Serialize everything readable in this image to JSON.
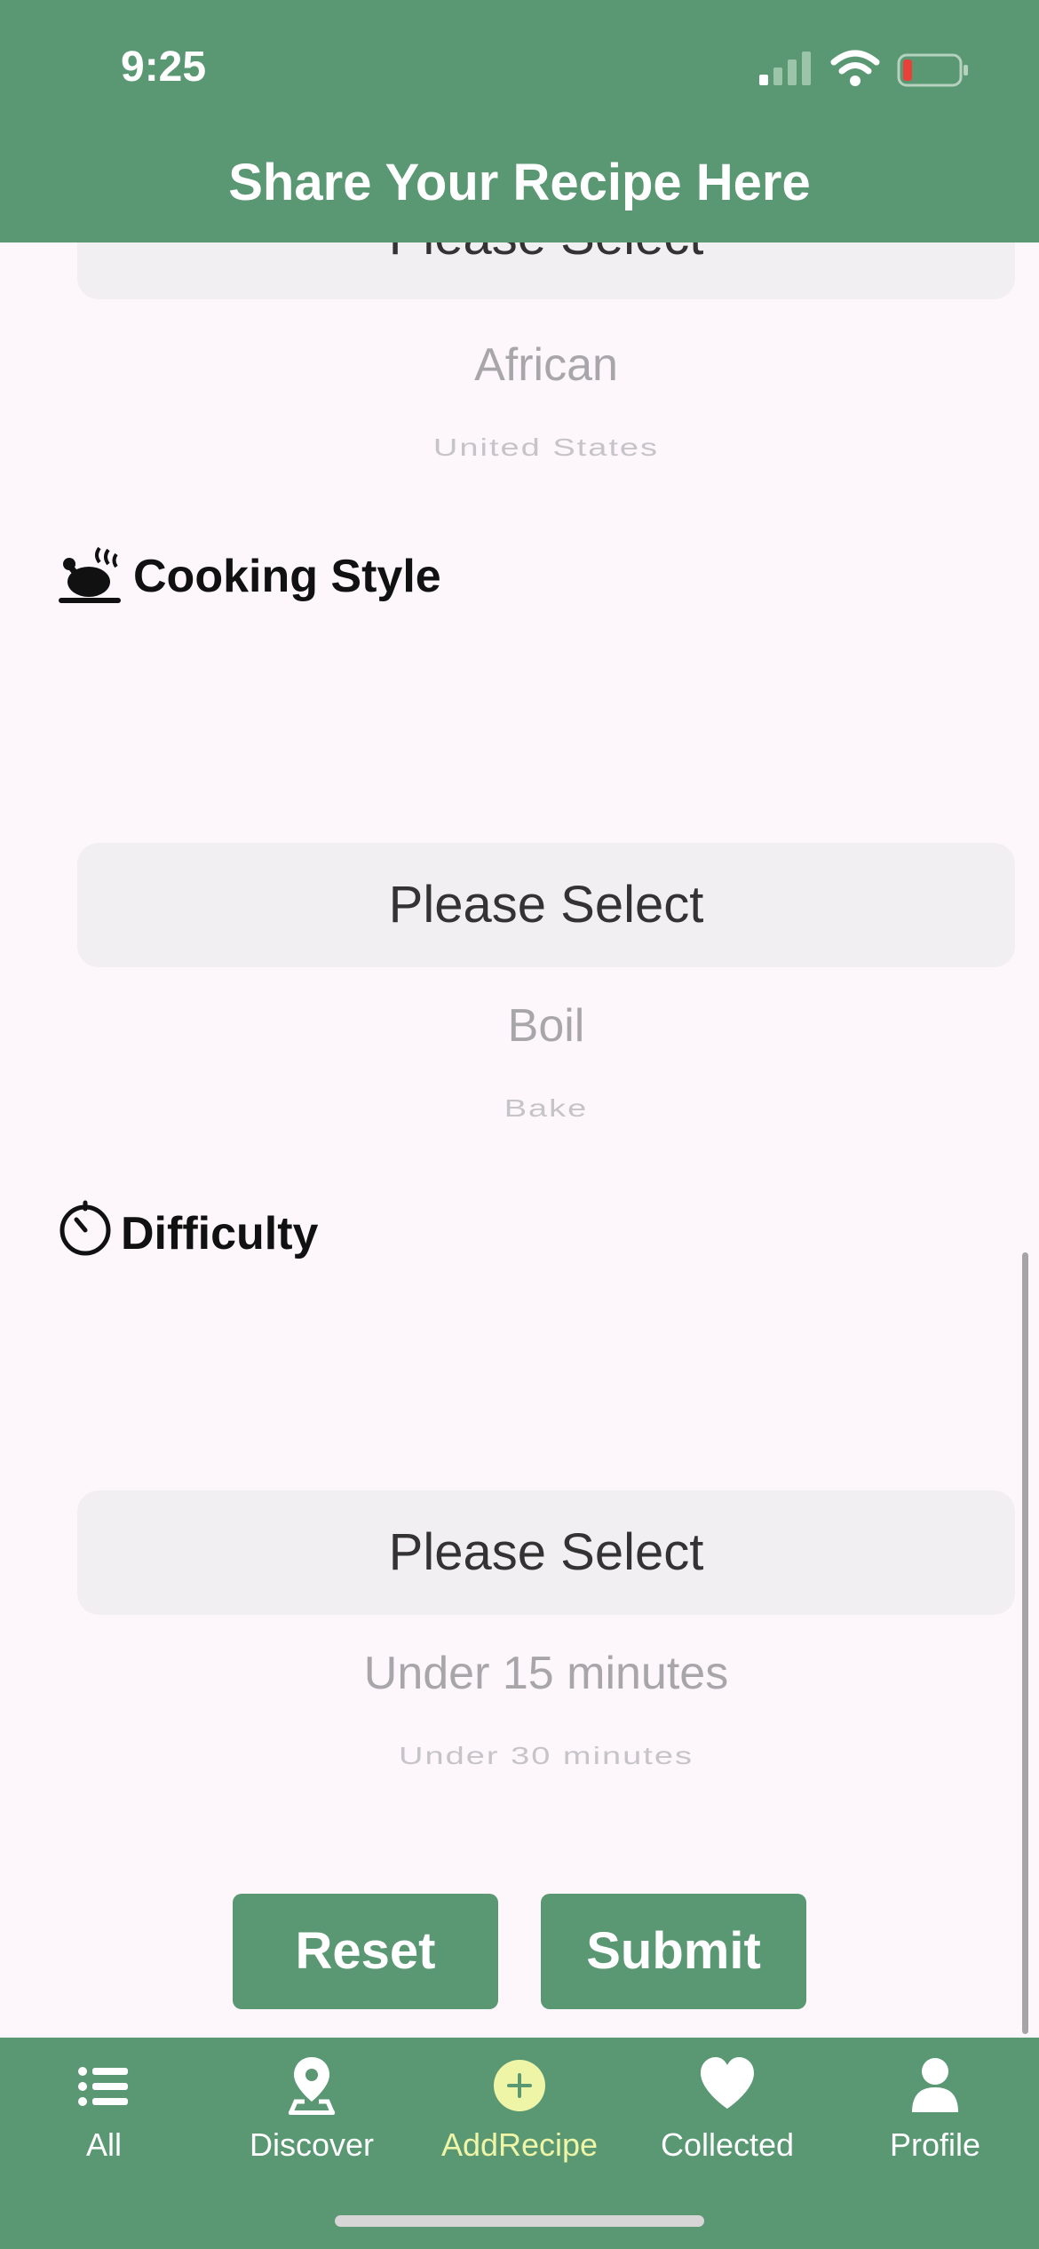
{
  "status": {
    "time": "9:25"
  },
  "header": {
    "title": "Share Your Recipe Here"
  },
  "cuisine_picker": {
    "selected": "Please Select",
    "option1": "African",
    "option2": "United States"
  },
  "cooking_style": {
    "label": "Cooking Style",
    "icon": "roast-chicken-icon"
  },
  "cooking_picker": {
    "selected": "Please Select",
    "option1": "Boil",
    "option2": "Bake"
  },
  "difficulty": {
    "label": "Difficulty",
    "icon": "timer-icon"
  },
  "difficulty_picker": {
    "selected": "Please Select",
    "option1": "Under 15 minutes",
    "option2": "Under 30 minutes"
  },
  "actions": {
    "reset": "Reset",
    "submit": "Submit"
  },
  "tabs": [
    {
      "label": "All",
      "icon": "list-icon"
    },
    {
      "label": "Discover",
      "icon": "map-pin-icon"
    },
    {
      "label": "AddRecipe",
      "icon": "plus-circle-icon",
      "active": true
    },
    {
      "label": "Collected",
      "icon": "heart-icon"
    },
    {
      "label": "Profile",
      "icon": "person-icon"
    }
  ],
  "colors": {
    "brand": "#5a9873",
    "active_tab": "#eef5a7",
    "background": "#fdf7fc"
  }
}
